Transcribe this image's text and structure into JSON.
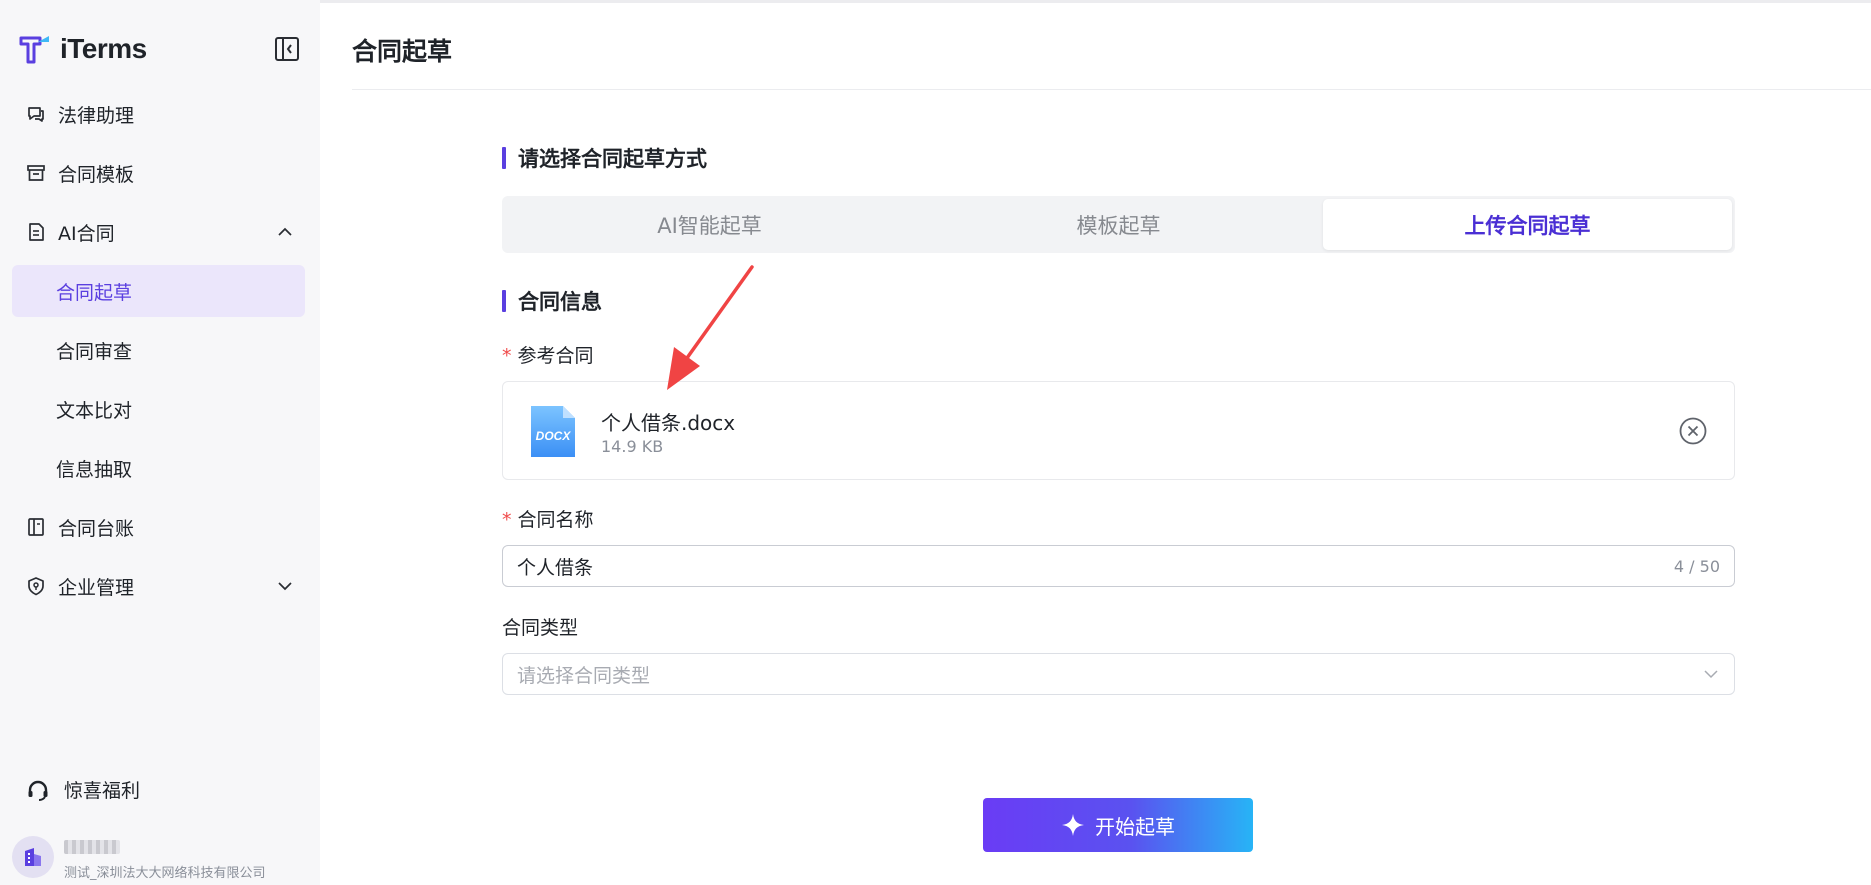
{
  "app": {
    "brand": "iTerms"
  },
  "sidebar": {
    "items": [
      {
        "label": "法律助理",
        "icon": "chat-icon"
      },
      {
        "label": "合同模板",
        "icon": "archive-icon"
      },
      {
        "label": "AI合同",
        "icon": "document-icon",
        "expanded": true
      },
      {
        "label": "合同起草",
        "active": true
      },
      {
        "label": "合同审查"
      },
      {
        "label": "文本比对"
      },
      {
        "label": "信息抽取"
      },
      {
        "label": "合同台账",
        "icon": "ledger-icon"
      },
      {
        "label": "企业管理",
        "icon": "shield-icon",
        "expanded": false
      }
    ],
    "bottom": {
      "label": "惊喜福利",
      "icon": "headset-icon"
    },
    "user": {
      "org": "测试_深圳法大大网络科技有限公司"
    }
  },
  "page": {
    "title": "合同起草"
  },
  "method_section": {
    "title": "请选择合同起草方式",
    "tabs": [
      {
        "label": "AI智能起草"
      },
      {
        "label": "模板起草"
      },
      {
        "label": "上传合同起草",
        "active": true
      }
    ]
  },
  "info_section": {
    "title": "合同信息",
    "reference": {
      "required_mark": "*",
      "label": "参考合同",
      "file": {
        "name": "个人借条.docx",
        "size": "14.9 KB",
        "type_badge": "DOCX"
      }
    },
    "name_field": {
      "required_mark": "*",
      "label": "合同名称",
      "value": "个人借条",
      "counter": "4 / 50"
    },
    "type_field": {
      "label": "合同类型",
      "placeholder": "请选择合同类型"
    }
  },
  "actions": {
    "start_label": "开始起草"
  },
  "colors": {
    "accent": "#5a3fe0",
    "required": "#f04a4a",
    "annotation": "#f04444",
    "button_gradient_start": "#6a3cf5",
    "button_gradient_end": "#27b4f6"
  }
}
